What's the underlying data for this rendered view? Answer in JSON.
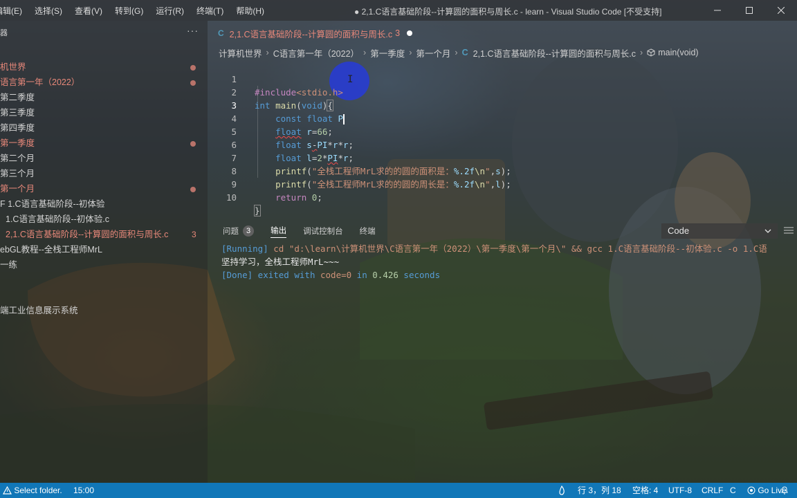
{
  "titlebar": {
    "menu": [
      "编辑(E)",
      "选择(S)",
      "查看(V)",
      "转到(G)",
      "运行(R)",
      "终端(T)",
      "帮助(H)"
    ],
    "window_title": "● 2,1.C语言基础阶段--计算圆的面积与周长.c - learn - Visual Studio Code [不受支持]"
  },
  "sidebar": {
    "header": "器",
    "more": "···",
    "items": [
      {
        "label": "机世界",
        "modified": true
      },
      {
        "label": "语言第一年（2022）",
        "modified": true
      },
      {
        "label": "第二季度",
        "modified": false
      },
      {
        "label": "第三季度",
        "modified": false
      },
      {
        "label": "第四季度",
        "modified": false
      },
      {
        "label": "第一季度",
        "modified": true
      },
      {
        "label": "第二个月",
        "modified": false
      },
      {
        "label": "第三个月",
        "modified": false
      },
      {
        "label": "第一个月",
        "modified": true
      },
      {
        "label": "F 1.C语言基础阶段--初体验",
        "modified": false
      },
      {
        "label": "1.C语言基础阶段--初体验.c",
        "modified": false
      },
      {
        "label": "2,1.C语言基础阶段--计算圆的面积与周长.c",
        "modified": true,
        "count": "3"
      },
      {
        "label": "ebGL教程--全栈工程师MrL",
        "modified": false
      },
      {
        "label": "一练",
        "modified": false
      },
      {
        "label": "端工业信息展示系统",
        "modified": false
      }
    ]
  },
  "tab": {
    "lang": "C",
    "label": "2,1.C语言基础阶段--计算圆的面积与周长.c",
    "count": "3"
  },
  "breadcrumb": {
    "items": [
      "计算机世界",
      "C语言第一年（2022）",
      "第一季度",
      "第一个月"
    ],
    "file": "2,1.C语言基础阶段--计算圆的面积与周长.c",
    "symbol": "main(void)"
  },
  "editor": {
    "line_numbers": [
      "1",
      "2",
      "3",
      "4",
      "5",
      "6",
      "7",
      "8",
      "9",
      "10"
    ],
    "l1": {
      "pp": "#include",
      "hdr": "<stdio.h>"
    },
    "l2": {
      "kw": "int",
      "fn": "main",
      "p1": "(",
      "kw2": "void",
      "p2": ")",
      "brace": "{"
    },
    "l3": {
      "kw": "const",
      "kw2": "float",
      "var": "P"
    },
    "l4": {
      "kw": "float",
      "var": "r",
      "eq": "=",
      "num": "66",
      "end": ";"
    },
    "l5": {
      "kw": "float",
      "var": "s",
      "op": "-",
      "var2": "PI",
      "op2": "*",
      "var3": "r",
      "op3": "*",
      "var4": "r",
      "end": ";"
    },
    "l6": {
      "kw": "float",
      "var": "l",
      "eq": "=",
      "num": "2",
      "op": "*",
      "var2": "PI",
      "op2": "*",
      "var3": "r",
      "end": ";"
    },
    "l7": {
      "fn": "printf",
      "p1": "(",
      "str": "\"全栈工程师MrL求的的圆的面积是：",
      "fmt": "%.2f",
      "esc": "\\n",
      "q": "\"",
      "sep": ",",
      "var": "s",
      "end": ");"
    },
    "l8": {
      "fn": "printf",
      "p1": "(",
      "str": "\"全栈工程师MrL求的的圆的周长是：",
      "fmt": "%.2f",
      "esc": "\\n",
      "q": "\"",
      "sep": ",",
      "var": "l",
      "end": ");"
    },
    "l9": {
      "kw": "return",
      "num": "0",
      "end": ";"
    },
    "l10": {
      "brace": "}"
    }
  },
  "panel": {
    "tabs": [
      {
        "label": "问题",
        "badge": "3"
      },
      {
        "label": "输出"
      },
      {
        "label": "调试控制台"
      },
      {
        "label": "终端"
      }
    ],
    "channel": "Code",
    "output": {
      "running_tag": "[Running]",
      "running_cmd": " cd \"d:\\learn\\计算机世界\\C语言第一年（2022）\\第一季度\\第一个月\\\" && gcc 1.C语言基础阶段--初体验.c -o 1.C语",
      "program_output": "坚持学习，全栈工程师MrL~~~",
      "done_tag": "[Done]",
      "done_text1": " exited with ",
      "done_code": "code=0",
      "done_text2": " in ",
      "done_time": "0.426",
      "done_text3": " seconds"
    }
  },
  "statusbar": {
    "folder": "Select folder.",
    "time": "15:00",
    "position": "行 3，列 18",
    "spaces": "空格: 4",
    "encoding": "UTF-8",
    "eol": "CRLF",
    "language": "C",
    "golive": "Go Live"
  },
  "colors": {
    "statusbar": "#1177b8",
    "modified": "#e8887a",
    "keyword": "#569cd6",
    "string": "#ce9178"
  }
}
